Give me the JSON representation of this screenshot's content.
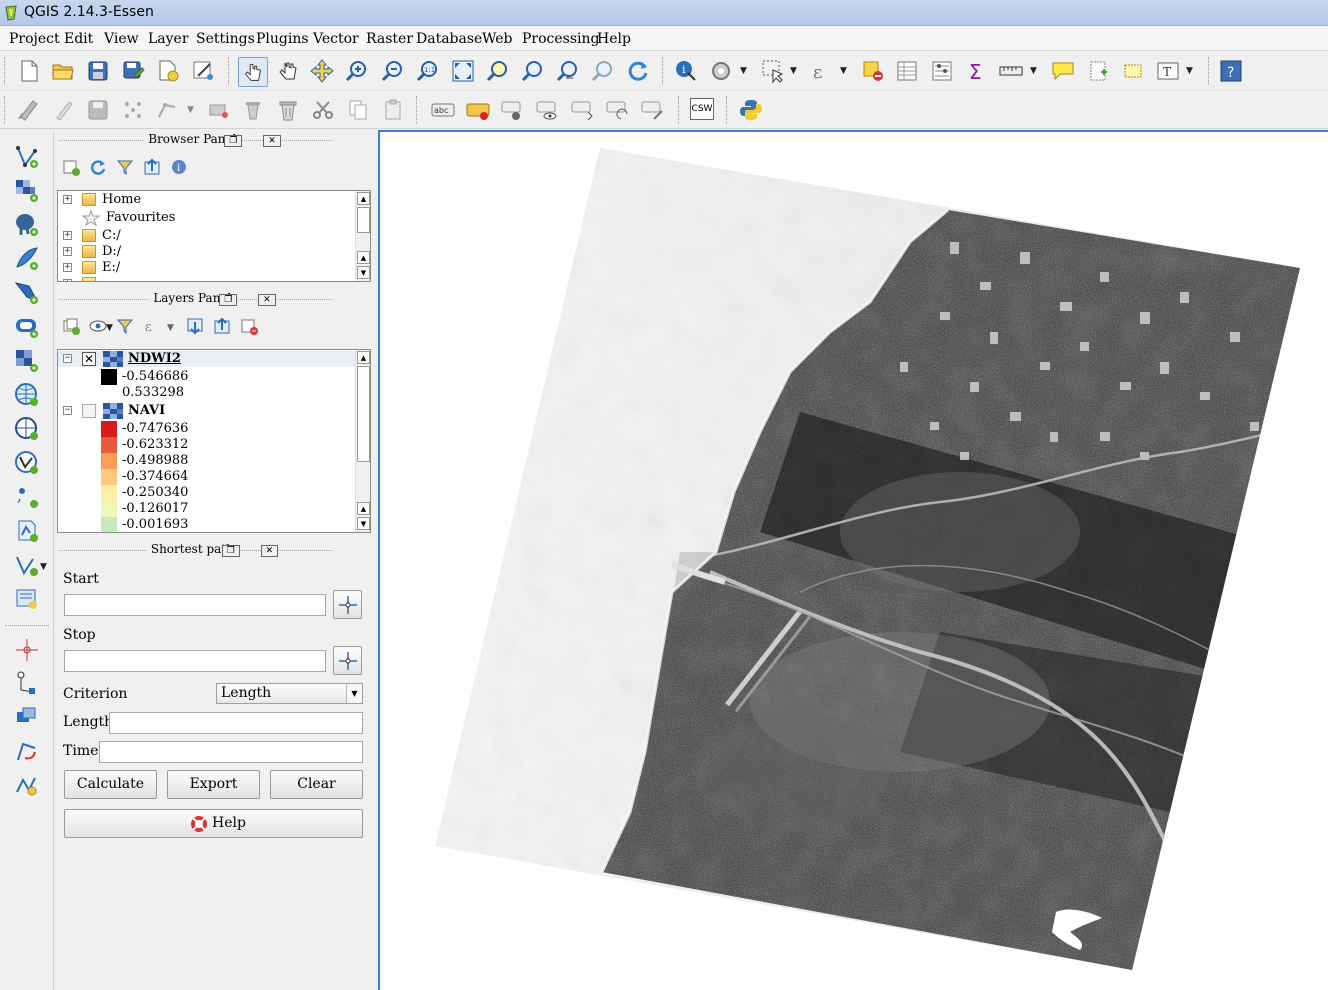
{
  "window": {
    "title": "QGIS 2.14.3-Essen"
  },
  "menu": {
    "items": [
      "Project",
      "Edit",
      "View",
      "Layer",
      "Settings",
      "Plugins",
      "Vector",
      "Raster",
      "Database",
      "Web",
      "Processing",
      "Help"
    ]
  },
  "toolbar": {
    "csw_label": "CSW",
    "abc_label": "abc"
  },
  "browser_panel": {
    "title": "Browser Panel",
    "items": [
      "Home",
      "Favourites",
      "C:/",
      "D:/",
      "E:/"
    ]
  },
  "layers_panel": {
    "title": "Layers Panel",
    "layers": [
      {
        "name": "NDWI2",
        "checked": true,
        "legend": [
          {
            "label": "-0.546686",
            "color": "#000000"
          },
          {
            "label": "0.533298",
            "color": "#ffffff"
          }
        ]
      },
      {
        "name": "NAVI",
        "checked": false,
        "legend": [
          {
            "label": "-0.747636",
            "color": "#d7191c"
          },
          {
            "label": "-0.623312",
            "color": "#e85b3a"
          },
          {
            "label": "-0.498988",
            "color": "#f99e59"
          },
          {
            "label": "-0.374664",
            "color": "#fec980"
          },
          {
            "label": "-0.250340",
            "color": "#ffedaa"
          },
          {
            "label": "-0.126017",
            "color": "#ecf7b9"
          },
          {
            "label": "-0.001693",
            "color": "#c7e9c0"
          }
        ]
      }
    ]
  },
  "shortest_path": {
    "title": "Shortest path",
    "start_label": "Start",
    "start_value": "",
    "stop_label": "Stop",
    "stop_value": "",
    "criterion_label": "Criterion",
    "criterion_value": "Length",
    "length_label": "Length",
    "length_value": "",
    "time_label": "Time",
    "time_value": "",
    "calculate_label": "Calculate",
    "export_label": "Export",
    "clear_label": "Clear",
    "help_label": "Help"
  },
  "colors": {
    "map_border": "#3b7fd1",
    "accent": "#2a6ebb"
  }
}
